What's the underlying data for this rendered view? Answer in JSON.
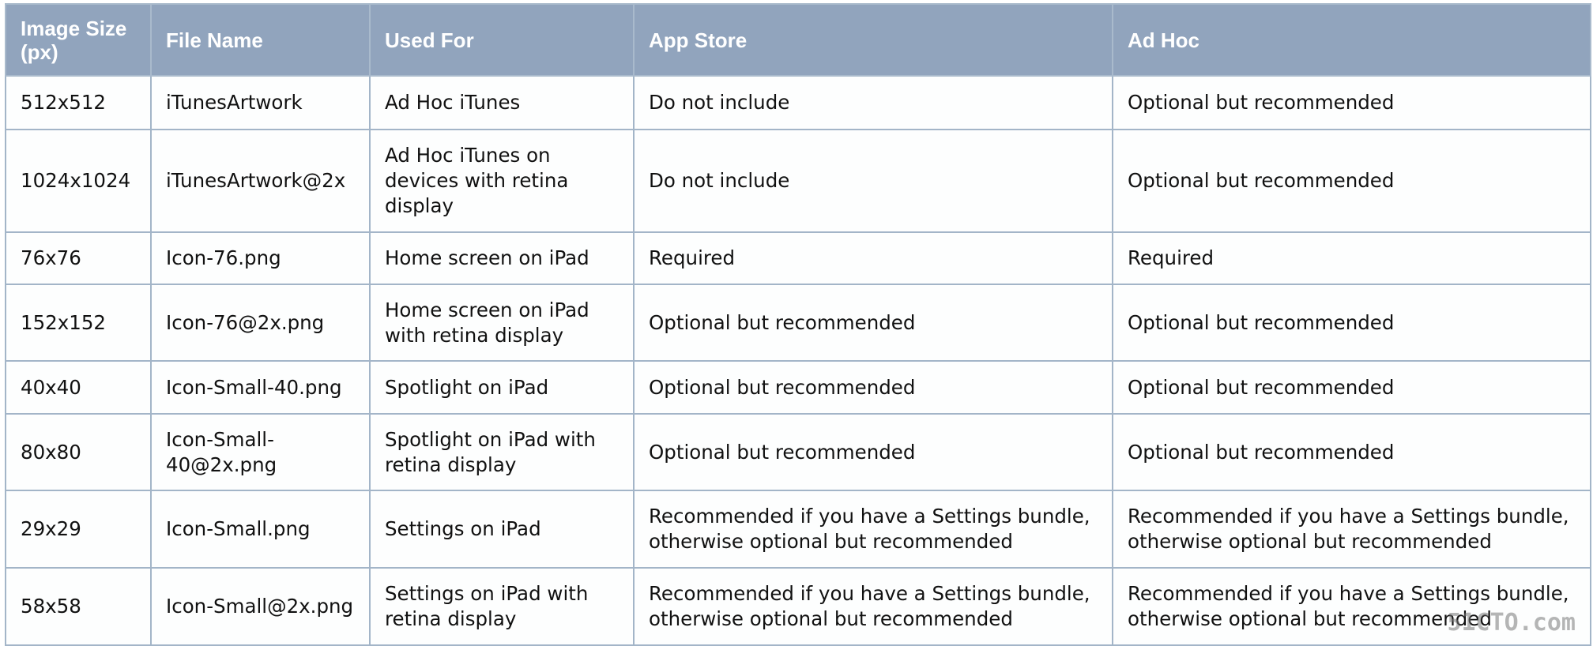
{
  "table": {
    "headers": [
      "Image Size (px)",
      "File Name",
      "Used For",
      "App Store",
      "Ad Hoc"
    ],
    "rows": [
      [
        "512x512",
        "iTunesArtwork",
        "Ad Hoc iTunes",
        "Do not include",
        "Optional but recommended"
      ],
      [
        "1024x1024",
        "iTunesArtwork@2x",
        "Ad Hoc iTunes on devices with retina display",
        "Do not include",
        "Optional but recommended"
      ],
      [
        "76x76",
        "Icon-76.png",
        "Home screen on iPad",
        "Required",
        "Required"
      ],
      [
        "152x152",
        "Icon-76@2x.png",
        "Home screen on iPad with retina display",
        "Optional but recommended",
        "Optional but recommended"
      ],
      [
        "40x40",
        "Icon-Small-40.png",
        "Spotlight on iPad",
        "Optional but recommended",
        "Optional but recommended"
      ],
      [
        "80x80",
        "Icon-Small-40@2x.png",
        "Spotlight on iPad with retina display",
        "Optional but recommended",
        "Optional but recommended"
      ],
      [
        "29x29",
        "Icon-Small.png",
        "Settings on iPad",
        "Recommended if you have a Settings bundle, otherwise optional but recommended",
        "Recommended if you have a Settings bundle, otherwise optional but recommended"
      ],
      [
        "58x58",
        "Icon-Small@2x.png",
        "Settings on iPad with retina display",
        "Recommended if you have a Settings bundle, otherwise optional but recommended",
        "Recommended if you have a Settings bundle, otherwise optional but recommended"
      ]
    ]
  },
  "watermark": "51CTO.com 技术 创新互联",
  "colors": {
    "header_bg": "#91a4bd",
    "border": "#a3b5c8"
  }
}
